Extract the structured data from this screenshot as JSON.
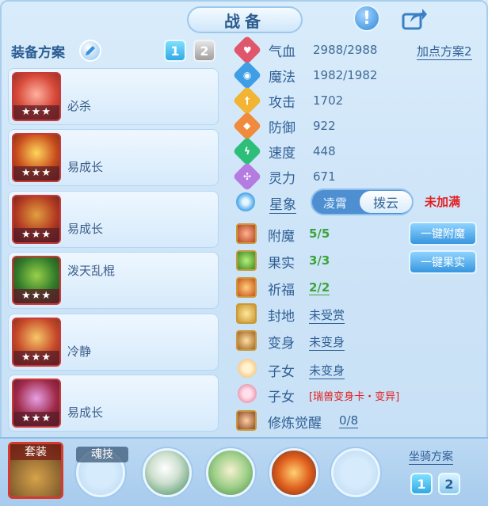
{
  "header": {
    "title": "战备"
  },
  "equipment": {
    "plan_label": "装备方案",
    "plans": [
      "1",
      "2"
    ],
    "active_plan": "1",
    "items": [
      {
        "name": "必杀",
        "stars": "★★★"
      },
      {
        "name": "易成长",
        "stars": "★★★"
      },
      {
        "name": "易成长",
        "stars": "★★★"
      },
      {
        "name": "泼天乱棍",
        "stars": "★★★"
      },
      {
        "name": "冷静",
        "stars": "★★★"
      },
      {
        "name": "易成长",
        "stars": "★★★"
      }
    ]
  },
  "stats": {
    "add_plan_label": "加点方案2",
    "rows": [
      {
        "label": "气血",
        "value": "2988/2988",
        "color": "#e0566b"
      },
      {
        "label": "魔法",
        "value": "1982/1982",
        "color": "#3f9ee6"
      },
      {
        "label": "攻击",
        "value": "1702",
        "color": "#f2b433"
      },
      {
        "label": "防御",
        "value": "922",
        "color": "#f08a3c"
      },
      {
        "label": "速度",
        "value": "448",
        "color": "#2dbf7a"
      },
      {
        "label": "灵力",
        "value": "671",
        "color": "#b47be0"
      }
    ]
  },
  "xingxiang": {
    "label": "星象",
    "option_left": "凌霄",
    "option_right": "拨云",
    "status": "未加满"
  },
  "extras": {
    "fumo": {
      "label": "附魔",
      "value": "5/5",
      "button": "一键附魔"
    },
    "guoshi": {
      "label": "果实",
      "value": "3/3",
      "button": "一键果实"
    },
    "qifu": {
      "label": "祈福",
      "value": "2/2"
    },
    "fengdi": {
      "label": "封地",
      "value": "未受赏"
    },
    "bianshen": {
      "label": "变身",
      "value": "未变身"
    },
    "zinv1": {
      "label": "子女",
      "value": "未变身"
    },
    "zinv2": {
      "label": "子女",
      "value": "[瑞兽变身卡・变异]"
    },
    "xiulian": {
      "label": "修炼觉醒",
      "value": "0/8"
    }
  },
  "bottom": {
    "set_label": "套装",
    "soul_label": "魂技",
    "mount_label": "坐骑方案",
    "mount_plans": [
      "1",
      "2"
    ]
  }
}
